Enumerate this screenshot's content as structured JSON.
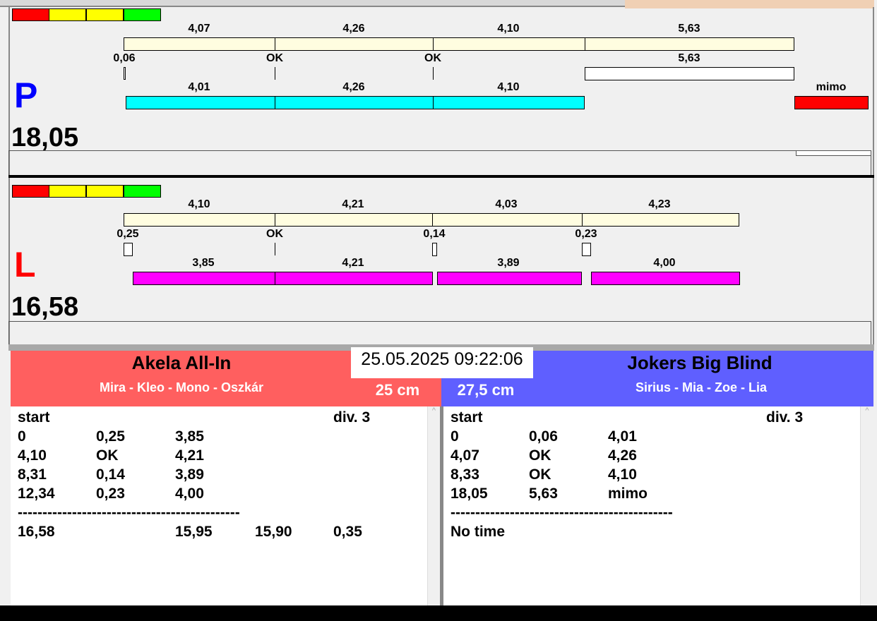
{
  "colors": {
    "cream": "#fffde0",
    "cyan": "#00ffff",
    "magenta": "#ff00ff",
    "red": "#ff0000",
    "teamA": "#ff5f5f",
    "teamB": "#5f5fff"
  },
  "legend": [
    "red",
    "yellow",
    "yellow",
    "green"
  ],
  "right": {
    "side": "P",
    "total": "18,05",
    "top_labels": [
      "4,07",
      "4,26",
      "4,10",
      "5,63"
    ],
    "mid_labels": [
      "0,06",
      "OK",
      "OK",
      "5,63"
    ],
    "bottom_labels": [
      "4,01",
      "4,26",
      "4,10"
    ],
    "out_label": "mimo"
  },
  "left": {
    "side": "L",
    "total": "16,58",
    "top_labels": [
      "4,10",
      "4,21",
      "4,03",
      "4,23"
    ],
    "mid_labels": [
      "0,25",
      "OK",
      "0,14",
      "0,23"
    ],
    "bottom_labels": [
      "3,85",
      "4,21",
      "3,89",
      "4,00"
    ]
  },
  "datetime": "25.05.2025 09:22:06",
  "teamA": {
    "name": "Akela All-In",
    "members": "Mira - Kleo - Mono - Oszkár",
    "size": "25 cm",
    "header": {
      "start": "start",
      "div": "div.  3"
    },
    "rows": [
      [
        "0",
        "0,25",
        "3,85"
      ],
      [
        "4,10",
        "OK",
        "4,21"
      ],
      [
        "8,31",
        "0,14",
        "3,89"
      ],
      [
        "12,34",
        "0,23",
        "4,00"
      ]
    ],
    "separator": "---------------------------------------------",
    "summary": [
      "16,58",
      "",
      "15,95",
      "15,90",
      "0,35"
    ]
  },
  "teamB": {
    "name": "Jokers Big Blind",
    "members": "Sirius - Mia - Zoe - Lia",
    "size": "27,5 cm",
    "header": {
      "start": "start",
      "div": "div.  3"
    },
    "rows": [
      [
        "0",
        "0,06",
        "4,01"
      ],
      [
        "4,07",
        "OK",
        "4,26"
      ],
      [
        "8,33",
        "OK",
        "4,10"
      ],
      [
        "18,05",
        "5,63",
        "mimo"
      ]
    ],
    "separator": "---------------------------------------------",
    "summary": [
      "No time"
    ]
  }
}
